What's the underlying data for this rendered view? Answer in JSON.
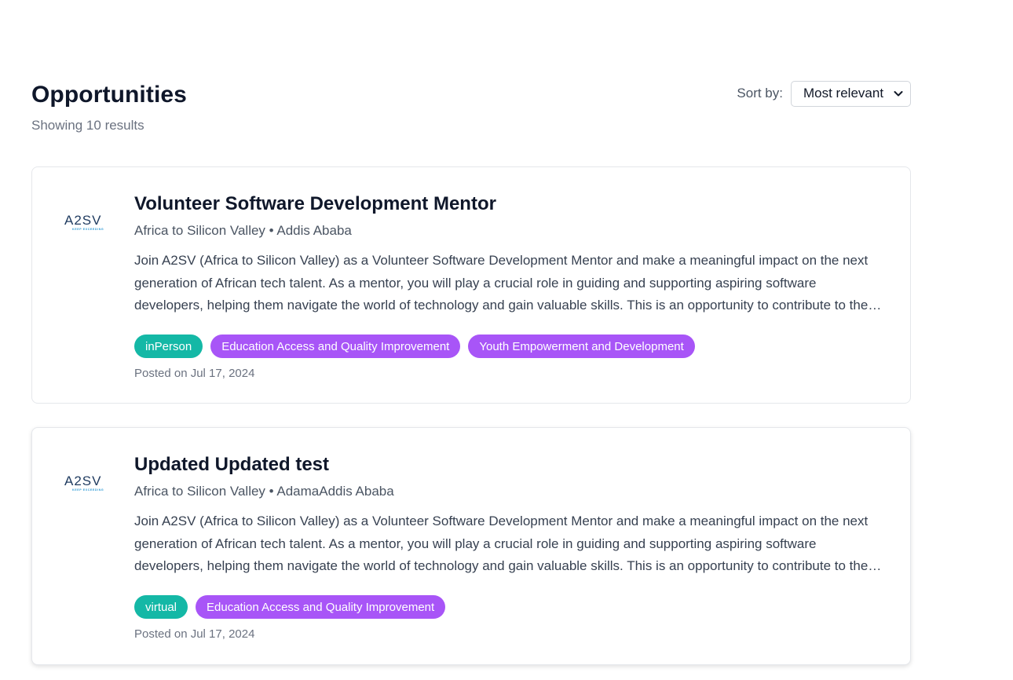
{
  "header": {
    "title": "Opportunities",
    "result_count": "Showing 10 results",
    "sort_label": "Sort by:",
    "sort_value": "Most relevant"
  },
  "cards": [
    {
      "logo_text": "A2SV",
      "logo_tagline": "KEEP EXCEEDING",
      "title": "Volunteer Software Development Mentor",
      "meta": "Africa to Silicon Valley • Addis Ababa",
      "description": "Join A2SV (Africa to Silicon Valley) as a Volunteer Software Development Mentor and make a meaningful impact on the next generation of African tech talent. As a mentor, you will play a crucial role in guiding and supporting aspiring software developers, helping them navigate the world of technology and gain valuable skills. This is an opportunity to contribute to the growth of the African tech ecosystem.",
      "tags": [
        "inPerson",
        "Education Access and Quality Improvement",
        "Youth Empowerment and Development"
      ],
      "posted": "Posted on Jul 17, 2024"
    },
    {
      "logo_text": "A2SV",
      "logo_tagline": "KEEP EXCEEDING",
      "title": "Updated Updated test",
      "meta": "Africa to Silicon Valley • AdamaAddis Ababa",
      "description": "Join A2SV (Africa to Silicon Valley) as a Volunteer Software Development Mentor and make a meaningful impact on the next generation of African tech talent. As a mentor, you will play a crucial role in guiding and supporting aspiring software developers, helping them navigate the world of technology and gain valuable skills. This is an opportunity to contribute to the growth of the African tech ecosystem.",
      "tags": [
        "virtual",
        "Education Access and Quality Improvement"
      ],
      "posted": "Posted on Jul 17, 2024"
    }
  ],
  "colors": {
    "tag_mode": "#14b8a6",
    "tag_category": "#a855f7",
    "logo_dark": "#1e3a5f",
    "logo_accent": "#2f9bd6"
  },
  "icons": {
    "sort_chevron": "chevron-down-icon",
    "company_logo": "a2sv-logo"
  }
}
